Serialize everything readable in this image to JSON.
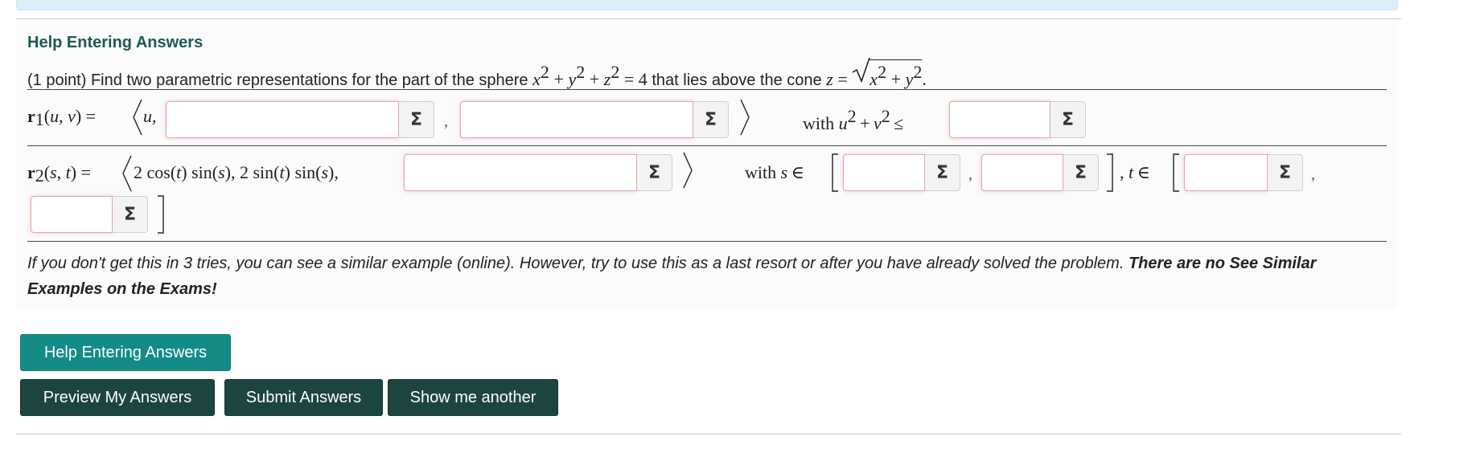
{
  "help_link": "Help Entering Answers",
  "problem": {
    "points": "(1 point)",
    "statement_a": "Find two parametric representations for the part of the sphere",
    "statement_b": "that lies above the cone",
    "sphere_eq": "x² + y² + z² = 4",
    "cone_eq": "z = √(x² + y²)"
  },
  "r1": {
    "label": "r₁(u, v) =",
    "first_component": "u,",
    "with_label": "with",
    "constraint": "u² + v² ≤",
    "answers": [
      "",
      "",
      ""
    ]
  },
  "r2": {
    "label": "r₂(s, t) =",
    "components": "2 cos(t) sin(s), 2 sin(t) sin(s),",
    "with_label": "with",
    "s_in": "s ∈",
    "t_in": "t ∈",
    "answers": [
      "",
      "",
      "",
      "",
      ""
    ]
  },
  "sigma_icon": "Σ",
  "note": {
    "italic": "If you don't get this in 3 tries, you can see a similar example (online). However, try to use this as a last resort or after you have already solved the problem.",
    "bold": "There are no See Similar Examples on the Exams!"
  },
  "buttons": {
    "help": "Help Entering Answers",
    "preview": "Preview My Answers",
    "submit": "Submit Answers",
    "another": "Show me another"
  }
}
